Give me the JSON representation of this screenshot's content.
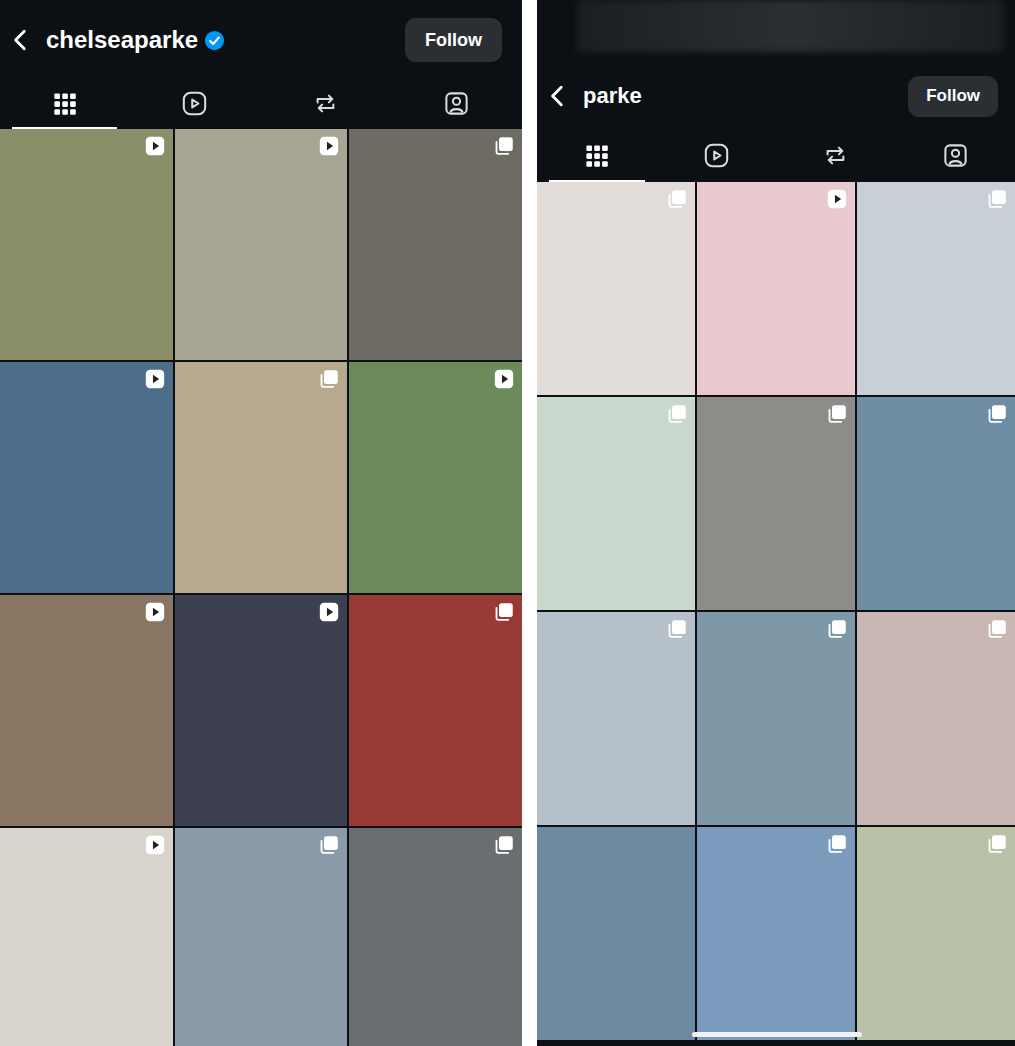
{
  "profiles": [
    {
      "username": "chelseaparke",
      "verified": true,
      "blurred_top_bar": false,
      "home_indicator": false,
      "follow_button": "Follow",
      "tabs": [
        {
          "kind": "grid",
          "selected": true
        },
        {
          "kind": "reels",
          "selected": false
        },
        {
          "kind": "reposts",
          "selected": false
        },
        {
          "kind": "tagged",
          "selected": false
        }
      ],
      "posts": [
        {
          "kind": "reel",
          "color": "#8a8f6a"
        },
        {
          "kind": "reel",
          "color": "#a8a595"
        },
        {
          "kind": "carousel",
          "color": "#6e6a64"
        },
        {
          "kind": "reel",
          "color": "#4d6e8a"
        },
        {
          "kind": "carousel",
          "color": "#b7a98e"
        },
        {
          "kind": "reel",
          "color": "#6d8a5a"
        },
        {
          "kind": "reel",
          "color": "#8a7462"
        },
        {
          "kind": "reel",
          "color": "#3c4050"
        },
        {
          "kind": "carousel",
          "color": "#9a3a34"
        },
        {
          "kind": "reel",
          "color": "#d8d4cc"
        },
        {
          "kind": "carousel",
          "color": "#8b9aa8"
        },
        {
          "kind": "carousel",
          "color": "#6a6e70"
        }
      ]
    },
    {
      "username": "parke",
      "verified": false,
      "blurred_top_bar": true,
      "home_indicator": true,
      "follow_button": "Follow",
      "tabs": [
        {
          "kind": "grid",
          "selected": true
        },
        {
          "kind": "reels",
          "selected": false
        },
        {
          "kind": "reposts",
          "selected": false
        },
        {
          "kind": "tagged",
          "selected": false
        }
      ],
      "posts": [
        {
          "kind": "carousel",
          "color": "#e2dcd8"
        },
        {
          "kind": "reel",
          "color": "#e9c9cf"
        },
        {
          "kind": "carousel",
          "color": "#c9cfd6"
        },
        {
          "kind": "carousel",
          "color": "#c8d8cc"
        },
        {
          "kind": "carousel",
          "color": "#8e8c88"
        },
        {
          "kind": "carousel",
          "color": "#6f8ea4"
        },
        {
          "kind": "carousel",
          "color": "#b5c0c9"
        },
        {
          "kind": "carousel",
          "color": "#7f98a8"
        },
        {
          "kind": "carousel",
          "color": "#c9b7b4"
        },
        {
          "kind": "photo",
          "color": "#6e8aa0"
        },
        {
          "kind": "carousel",
          "color": "#7d9cbd"
        },
        {
          "kind": "carousel",
          "color": "#b9c2a8"
        }
      ]
    }
  ]
}
